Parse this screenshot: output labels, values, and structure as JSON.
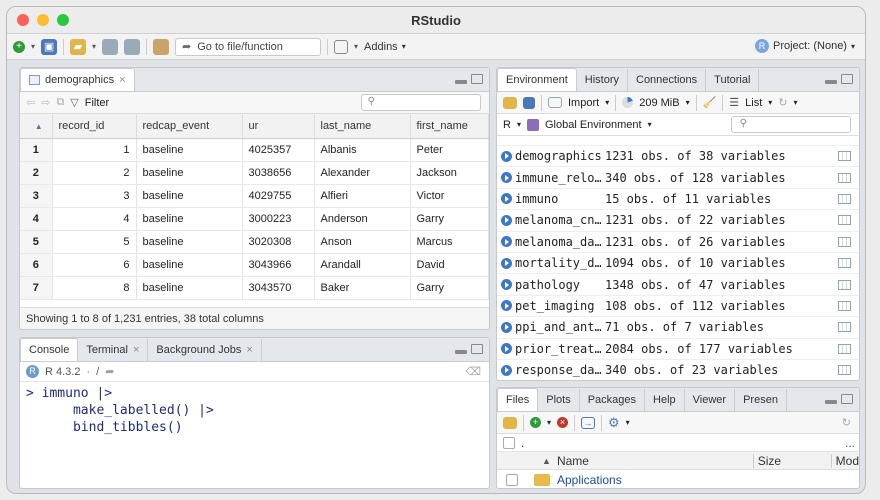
{
  "window": {
    "title": "RStudio"
  },
  "toolbar": {
    "goto_placeholder": "Go to file/function",
    "addins_label": "Addins",
    "project_label": "Project: (None)"
  },
  "source": {
    "tab_label": "demographics",
    "filter_label": "Filter",
    "columns": [
      "record_id",
      "redcap_event",
      "ur",
      "last_name",
      "first_name"
    ],
    "rows": [
      [
        "1",
        "1",
        "baseline",
        "4025357",
        "Albanis",
        "Peter"
      ],
      [
        "2",
        "2",
        "baseline",
        "3038656",
        "Alexander",
        "Jackson"
      ],
      [
        "3",
        "3",
        "baseline",
        "4029755",
        "Alfieri",
        "Victor"
      ],
      [
        "4",
        "4",
        "baseline",
        "3000223",
        "Anderson",
        "Garry"
      ],
      [
        "5",
        "5",
        "baseline",
        "3020308",
        "Anson",
        "Marcus"
      ],
      [
        "6",
        "6",
        "baseline",
        "3043966",
        "Arandall",
        "David"
      ],
      [
        "7",
        "8",
        "baseline",
        "3043570",
        "Baker",
        "Garry"
      ]
    ],
    "status": "Showing 1 to 8 of 1,231 entries, 38 total columns"
  },
  "console": {
    "tabs": [
      "Console",
      "Terminal",
      "Background Jobs"
    ],
    "r_version": "R 4.3.2",
    "path": "/",
    "lines": [
      "> immuno |>",
      "      make_labelled() |>",
      "      bind_tibbles()"
    ]
  },
  "environment": {
    "tabs": [
      "Environment",
      "History",
      "Connections",
      "Tutorial"
    ],
    "import_label": "Import",
    "memory_label": "209 MiB",
    "list_label": "List",
    "lang_label": "R",
    "scope_label": "Global Environment",
    "objects": [
      {
        "name": "demographics",
        "value": "1231 obs. of 38 variables"
      },
      {
        "name": "immune_relo…",
        "value": "340 obs. of 128 variables"
      },
      {
        "name": "immuno",
        "value": "15 obs. of 11 variables"
      },
      {
        "name": "melanoma_cn…",
        "value": "1231 obs. of 22 variables"
      },
      {
        "name": "melanoma_da…",
        "value": "1231 obs. of 26 variables"
      },
      {
        "name": "mortality_d…",
        "value": "1094 obs. of 10 variables"
      },
      {
        "name": "pathology",
        "value": "1348 obs. of 47 variables"
      },
      {
        "name": "pet_imaging",
        "value": "108 obs. of 112 variables"
      },
      {
        "name": "ppi_and_ant…",
        "value": "71 obs. of 7 variables"
      },
      {
        "name": "prior_treat…",
        "value": "2084 obs. of 177 variables"
      },
      {
        "name": "response_da…",
        "value": "340 obs. of 23 variables"
      }
    ]
  },
  "files": {
    "tabs": [
      "Files",
      "Plots",
      "Packages",
      "Help",
      "Viewer",
      "Presen"
    ],
    "path": ".",
    "more": "...",
    "columns": [
      "Name",
      "Size",
      "Mod"
    ],
    "items": [
      {
        "name": "Applications"
      }
    ]
  },
  "colors": {
    "close": "#fe5f57",
    "minimize": "#febc2e",
    "zoom": "#28c840",
    "accent": "#3c78c8"
  }
}
